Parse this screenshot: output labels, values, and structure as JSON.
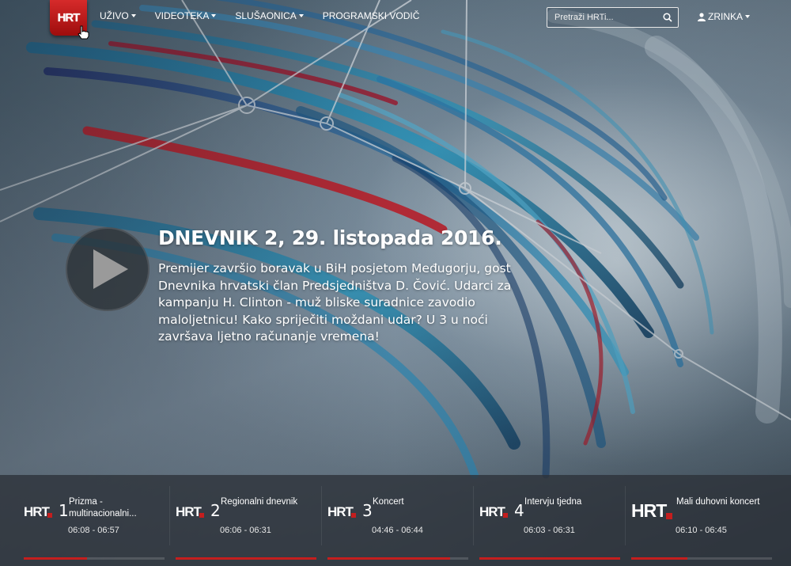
{
  "nav": {
    "logo_text": "HRT",
    "items": [
      {
        "label": "Uživo",
        "has_caret": true
      },
      {
        "label": "Videoteka",
        "has_caret": true
      },
      {
        "label": "Slušaonica",
        "has_caret": true
      },
      {
        "label": "Programski vodič",
        "has_caret": false
      }
    ],
    "search_placeholder": "Pretraži HRTi...",
    "user_name": "ZRINKA"
  },
  "hero": {
    "title": "DNEVNIK 2, 29. listopada 2016.",
    "description": "Premijer završio boravak u BiH posjetom Međugorju, gost Dnevnika hrvatski član Predsjedništva D. Čović. Udarci za kampanju H. Clinton - muž bliske suradnice zavodio maloljetnicu! Kako spriječiti moždani udar? U 3 u noći završava ljetno računanje vremena!"
  },
  "channels": [
    {
      "number": "1",
      "show": "Prizma - multinacionalni...",
      "time": "06:08 - 06:57",
      "progress": 0.45
    },
    {
      "number": "2",
      "show": "Regionalni dnevnik",
      "time": "06:06 - 06:31",
      "progress": 1.0
    },
    {
      "number": "3",
      "show": "Koncert",
      "time": "04:46 - 06:44",
      "progress": 0.87
    },
    {
      "number": "4",
      "show": "Intervju tjedna",
      "time": "06:03 - 06:31",
      "progress": 1.0
    },
    {
      "number": "",
      "show": "Mali duhovni koncert",
      "time": "06:10 - 06:45",
      "progress": 0.4
    }
  ],
  "colors": {
    "brand_red": "#c41e1e",
    "strip_bg": "#2d323a"
  },
  "icons": {
    "search": "search-icon",
    "user": "user-icon",
    "play": "play-icon"
  }
}
